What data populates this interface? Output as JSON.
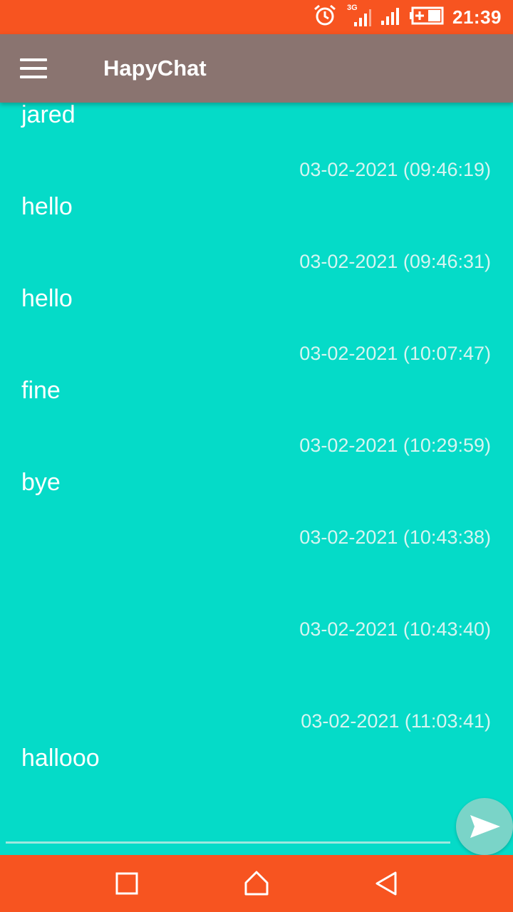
{
  "status_bar": {
    "time": "21:39",
    "network_label": "3G",
    "icons": [
      "alarm-icon",
      "signal-3g-icon",
      "signal-icon",
      "battery-icon"
    ]
  },
  "app_bar": {
    "title": "HapyChat",
    "menu_icon": "hamburger-menu-icon"
  },
  "messages": [
    {
      "text": "jared",
      "timestamp": "03-02-2021 (09:46:19)"
    },
    {
      "text": "hello",
      "timestamp": "03-02-2021 (09:46:31)"
    },
    {
      "text": "hello",
      "timestamp": "03-02-2021 (10:07:47)"
    },
    {
      "text": "fine",
      "timestamp": "03-02-2021 (10:29:59)"
    },
    {
      "text": "bye",
      "timestamp": "03-02-2021 (10:43:38)"
    },
    {
      "text": "",
      "timestamp": "03-02-2021 (10:43:40)"
    },
    {
      "text": "",
      "timestamp": "03-02-2021 (11:03:41)"
    },
    {
      "text": "hallooo",
      "timestamp": ""
    }
  ],
  "composer": {
    "input_value": "",
    "send_icon": "send-icon"
  },
  "nav_bar": {
    "icons": [
      "recents-icon",
      "home-icon",
      "back-icon"
    ]
  },
  "colors": {
    "status_bar": "#f75420",
    "app_bar": "#8a7470",
    "background": "#05dbc8",
    "send_button": "#7ad4c8"
  }
}
